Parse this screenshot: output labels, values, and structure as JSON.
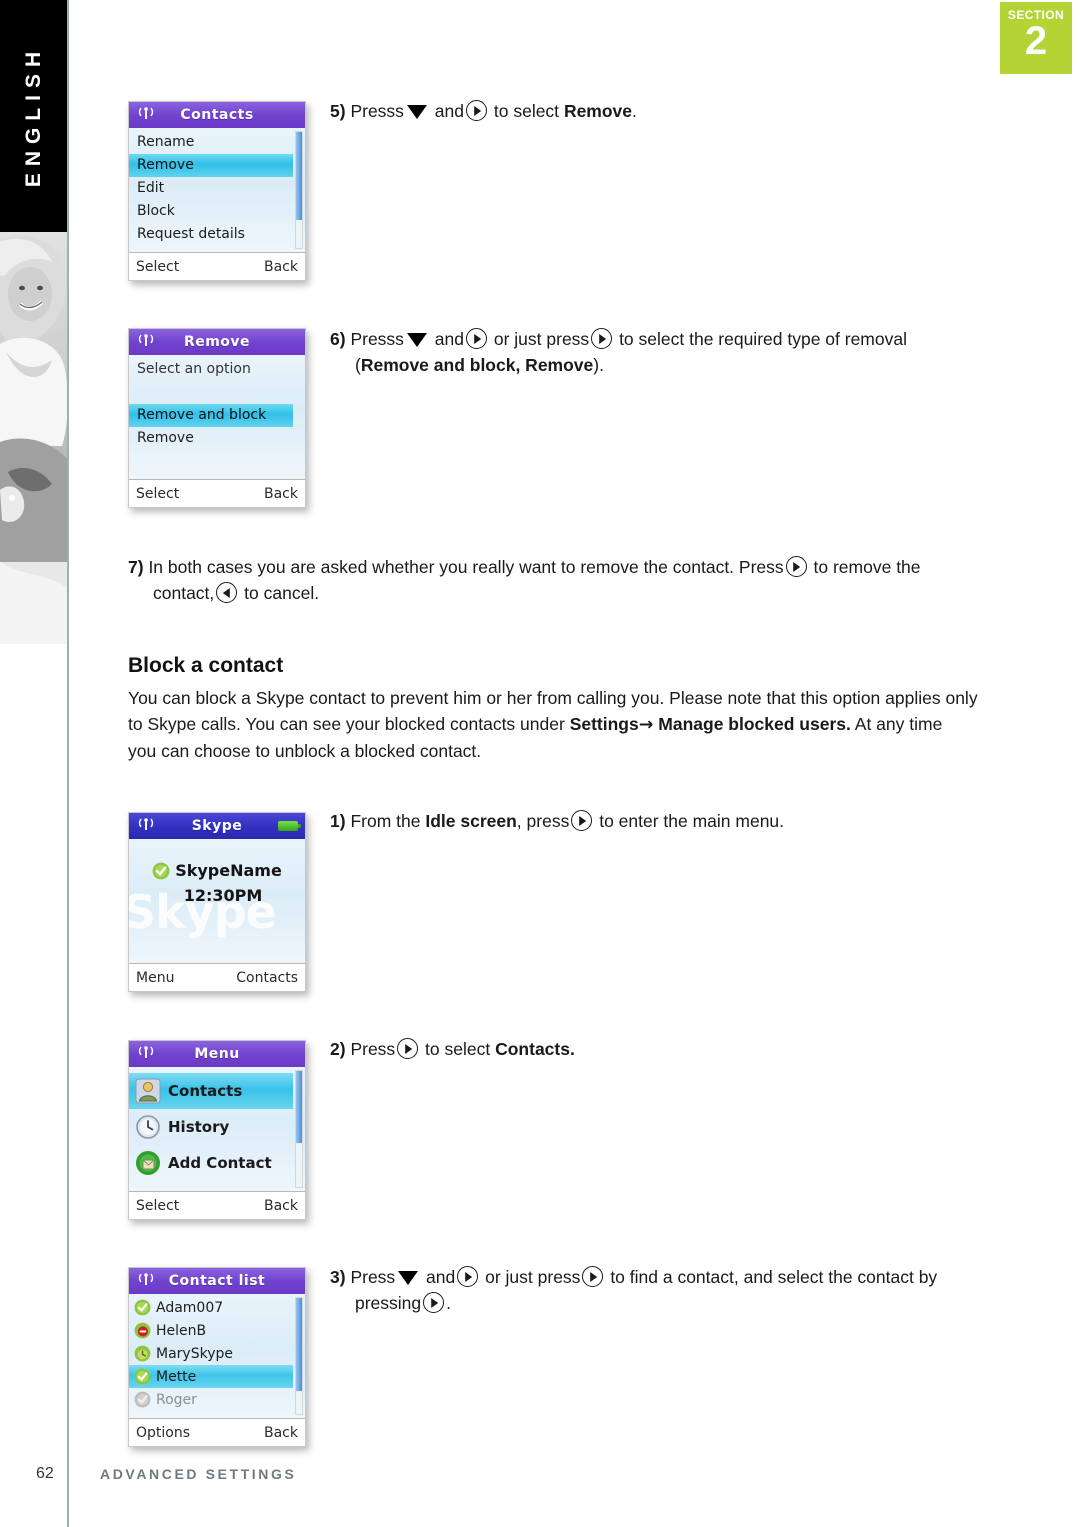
{
  "sidebar": {
    "language_label": "ENGLISH",
    "photo_alt": "woman-photo"
  },
  "section_badge": {
    "word": "SECTION",
    "number": "2"
  },
  "screens": {
    "contacts_options": {
      "title": "Contacts",
      "signal_icon": "signal-icon",
      "items": [
        "Rename",
        "Remove",
        "Edit",
        "Block",
        "Request details"
      ],
      "selected": "Remove",
      "softkey_left": "Select",
      "softkey_right": "Back"
    },
    "remove": {
      "title": "Remove",
      "signal_icon": "signal-icon",
      "hint": "Select an option",
      "items": [
        "Remove and block",
        "Remove"
      ],
      "selected": "Remove and block",
      "softkey_left": "Select",
      "softkey_right": "Back"
    },
    "idle": {
      "title": "Skype",
      "signal_icon": "signal-icon",
      "battery_icon": "battery-icon",
      "watermark": "Skype",
      "user_name": "SkypeName",
      "time": "12:30PM",
      "status_icon": "online-check-icon",
      "softkey_left": "Menu",
      "softkey_right": "Contacts"
    },
    "menu": {
      "title": "Menu",
      "signal_icon": "signal-icon",
      "items": [
        {
          "label": "Contacts",
          "icon": "contacts-icon"
        },
        {
          "label": "History",
          "icon": "clock-icon"
        },
        {
          "label": "Add Contact",
          "icon": "add-contact-icon"
        }
      ],
      "selected": "Contacts",
      "softkey_left": "Select",
      "softkey_right": "Back"
    },
    "contact_list": {
      "title": "Contact list",
      "signal_icon": "signal-icon",
      "items": [
        {
          "name": "Adam007",
          "status": "online"
        },
        {
          "name": "HelenB",
          "status": "do-not-disturb"
        },
        {
          "name": "MarySkype",
          "status": "away"
        },
        {
          "name": "Mette",
          "status": "online"
        },
        {
          "name": "Roger",
          "status": "offline"
        }
      ],
      "selected": "Mette",
      "softkey_left": "Options",
      "softkey_right": "Back"
    }
  },
  "steps": {
    "s5": {
      "num": "5)",
      "a": "Presss",
      "b": "and",
      "c": "to select",
      "d": "Remove",
      "e": "."
    },
    "s6": {
      "num": "6)",
      "a": "Presss",
      "b": "and",
      "c": "or just press",
      "d": "to select the required type of removal",
      "e": "(",
      "f": "Remove and block, Remove",
      "g": ")."
    },
    "s7": {
      "num": "7)",
      "a": "In both cases you are asked whether you really want to remove the contact. Press",
      "b": "to remove the",
      "c": "contact,",
      "d": "to cancel."
    },
    "s1": {
      "num": "1)",
      "a": "From the",
      "b": "Idle screen",
      "c": ", press",
      "d": "to enter the main menu."
    },
    "s2": {
      "num": "2)",
      "a": "Press",
      "b": "to select",
      "c": "Contacts."
    },
    "s3": {
      "num": "3)",
      "a": "Press",
      "b": "and",
      "c": "or just press",
      "d": "to find a contact, and select the contact by",
      "e": "pressing",
      "f": "."
    }
  },
  "block_section": {
    "heading": "Block a contact",
    "p1": "You can block a Skype contact to prevent him or her from calling you. Please note that this option applies only",
    "p2a": "to Skype calls. You can see your blocked contacts under",
    "p2b": "Settings",
    "p2arrow": "→",
    "p2c": "Manage blocked users.",
    "p2d": "At any time",
    "p3": "you can choose to unblock a blocked contact."
  },
  "footer": {
    "page_number": "62",
    "label": "ADVANCED SETTINGS"
  },
  "colors": {
    "section_badge_bg": "#b4d335",
    "titlebar_purple": "#7243cf",
    "titlebar_blue": "#3330c0",
    "highlight_cyan": "#2fc0e8",
    "footer_text": "#6f7a80"
  }
}
